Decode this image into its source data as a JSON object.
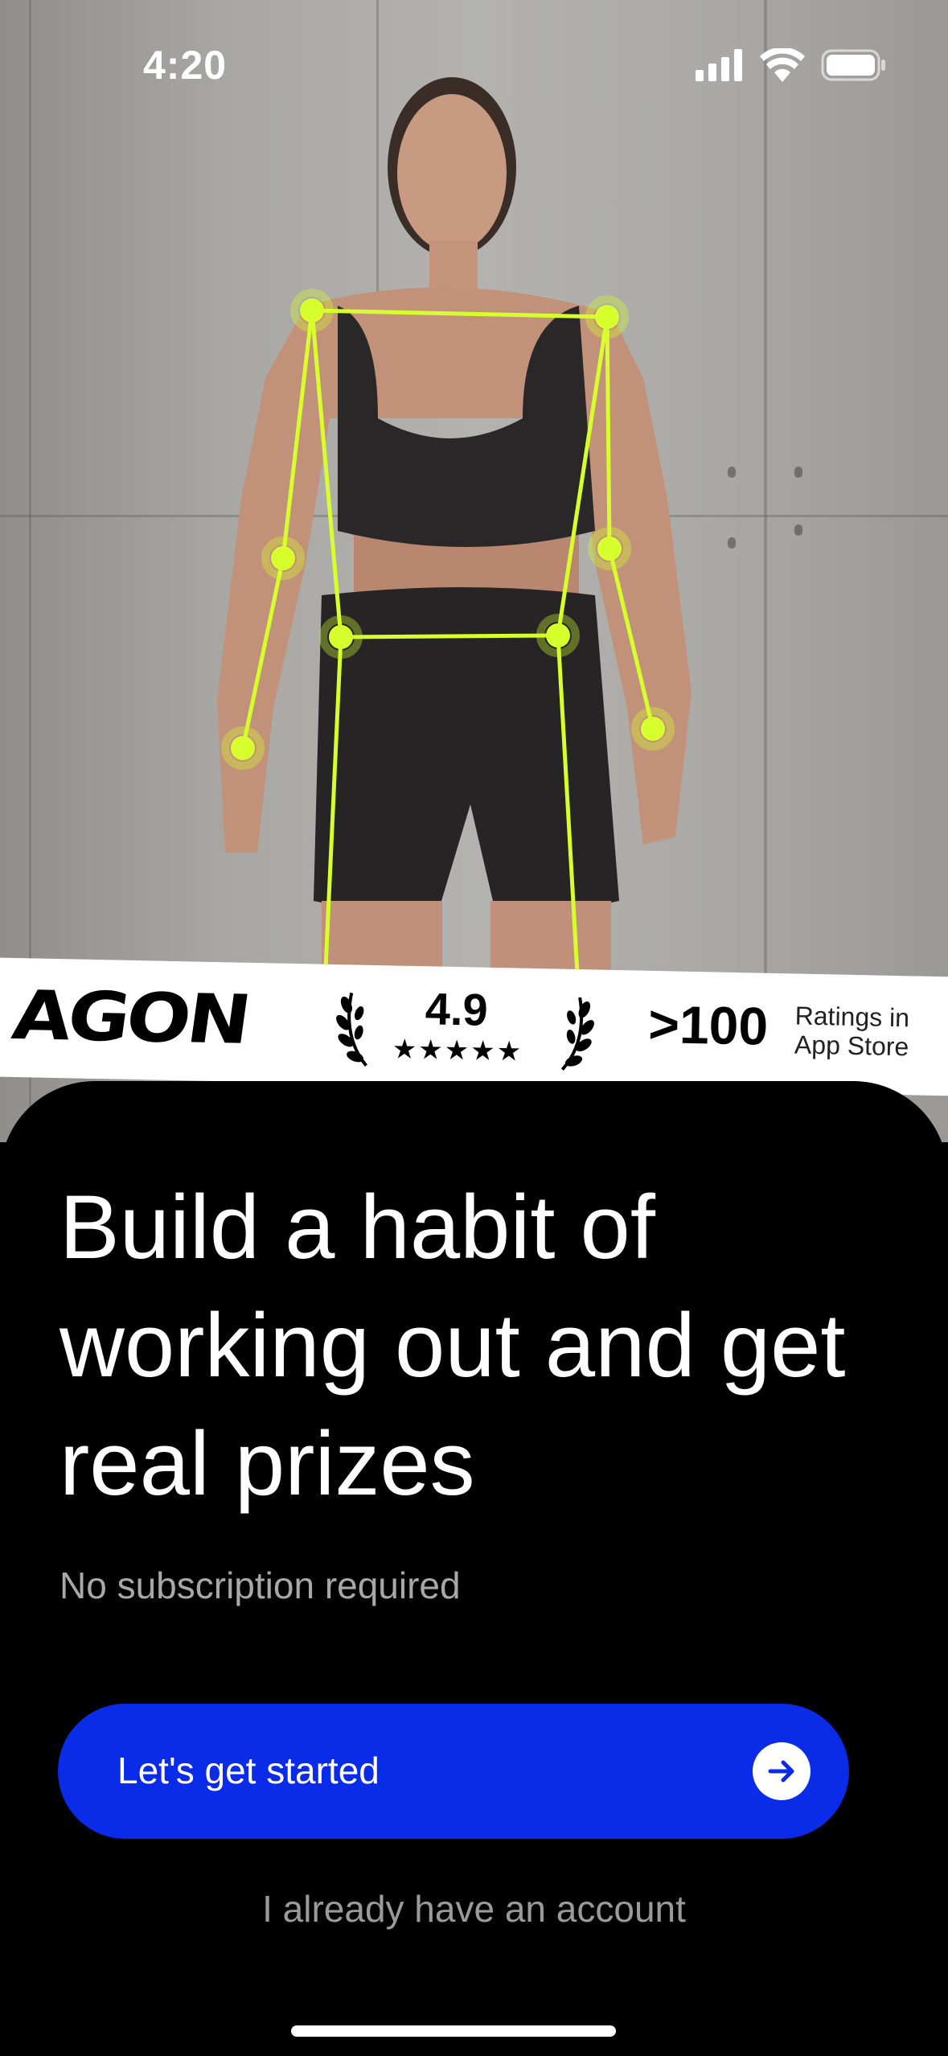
{
  "status_bar": {
    "time": "4:20",
    "icons": [
      "cellular-icon",
      "wifi-icon",
      "battery-icon"
    ]
  },
  "hero": {
    "image": "woman-pose-tracking-photo",
    "accent_color": "#d7ff2b"
  },
  "banner": {
    "brand": "AGON",
    "rating_value": "4.9",
    "rating_stars": "★★★★★",
    "ratings_count": ">100",
    "ratings_label_line1": "Ratings in",
    "ratings_label_line2": "App Store"
  },
  "main": {
    "headline": "Build a habit of working out and get real prizes",
    "subtext": "No subscription required",
    "primary_button_label": "Let's get started",
    "secondary_link": "I already have an account",
    "primary_color": "#0a2be8"
  }
}
